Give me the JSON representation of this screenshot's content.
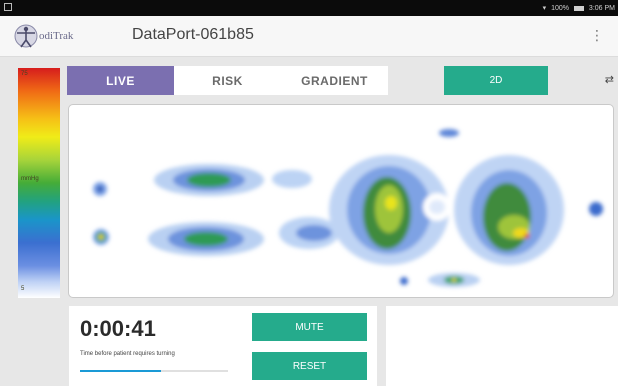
{
  "status_bar": {
    "battery": "100%",
    "time": "3:06 PM"
  },
  "app_bar": {
    "logo_text": "odiTrak",
    "title": "DataPort-061b85",
    "menu_icon": "overflow-menu-icon"
  },
  "legend": {
    "max_label": "75",
    "mid_label": "mmHg",
    "min_label": "5"
  },
  "tabs": [
    {
      "label": "LIVE",
      "active": true
    },
    {
      "label": "RISK",
      "active": false
    },
    {
      "label": "GRADIENT",
      "active": false
    }
  ],
  "view_toggle": {
    "label": "2D"
  },
  "timer": {
    "value": "0:00:41",
    "caption": "Time before patient requires turning",
    "progress": 0.55
  },
  "buttons": {
    "mute": "MUTE",
    "reset": "RESET"
  },
  "colors": {
    "accent": "#25ab8c",
    "active_tab": "#7b6fb0"
  }
}
